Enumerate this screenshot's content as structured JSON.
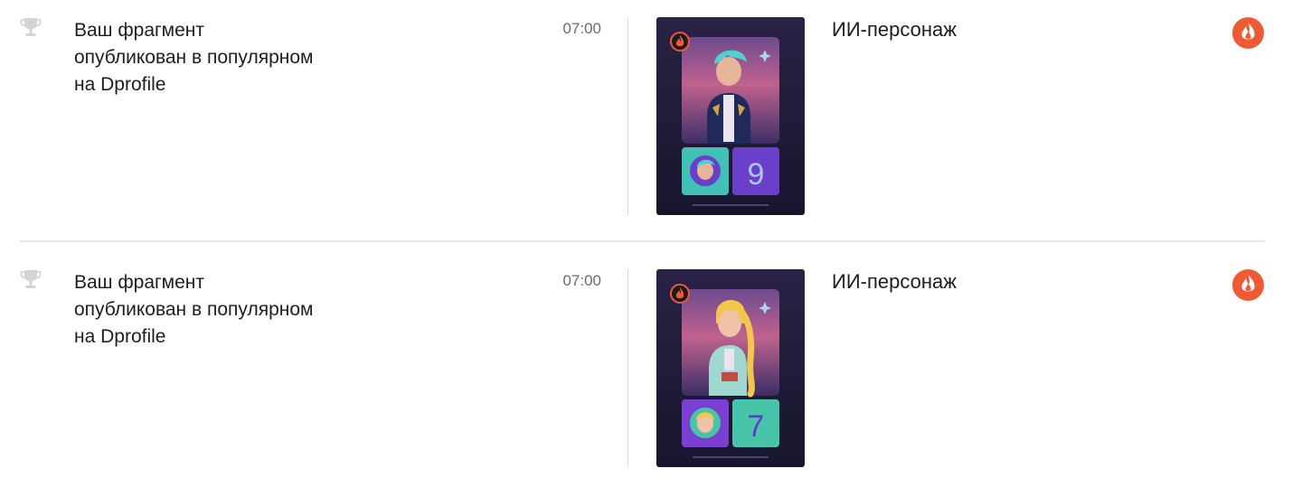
{
  "notifications": [
    {
      "message": "Ваш фрагмент опубликован в популярном на Dprofile",
      "message_lines": [
        "Ваш фрагмент",
        "опубликован в популярном",
        "на Dprofile"
      ],
      "time": "07:00",
      "preview": {
        "character": "male, teal hair, navy bomber jacket",
        "number": "9",
        "colors": {
          "tile_left": "#3fc1b5",
          "tile_right": "#6a3fc9",
          "hair": "#4fd2cf"
        }
      },
      "label": "ИИ-персонаж",
      "icon": "fire-icon"
    },
    {
      "message": "Ваш фрагмент опубликован в популярном на Dprofile",
      "message_lines": [
        "Ваш фрагмент",
        "опубликован в популярном",
        "на Dprofile"
      ],
      "time": "07:00",
      "preview": {
        "character": "female, blonde braid, mint jacket",
        "number": "7",
        "colors": {
          "tile_left": "#7a3fd0",
          "tile_right": "#48c5a8",
          "hair": "#f2c84a"
        }
      },
      "label": "ИИ-персонаж",
      "icon": "fire-icon"
    }
  ],
  "colors": {
    "accent": "#f05a33",
    "divider": "#d9d9d9",
    "time_text": "#6b6b6b",
    "thumb_bg": "#1d1b3a"
  }
}
